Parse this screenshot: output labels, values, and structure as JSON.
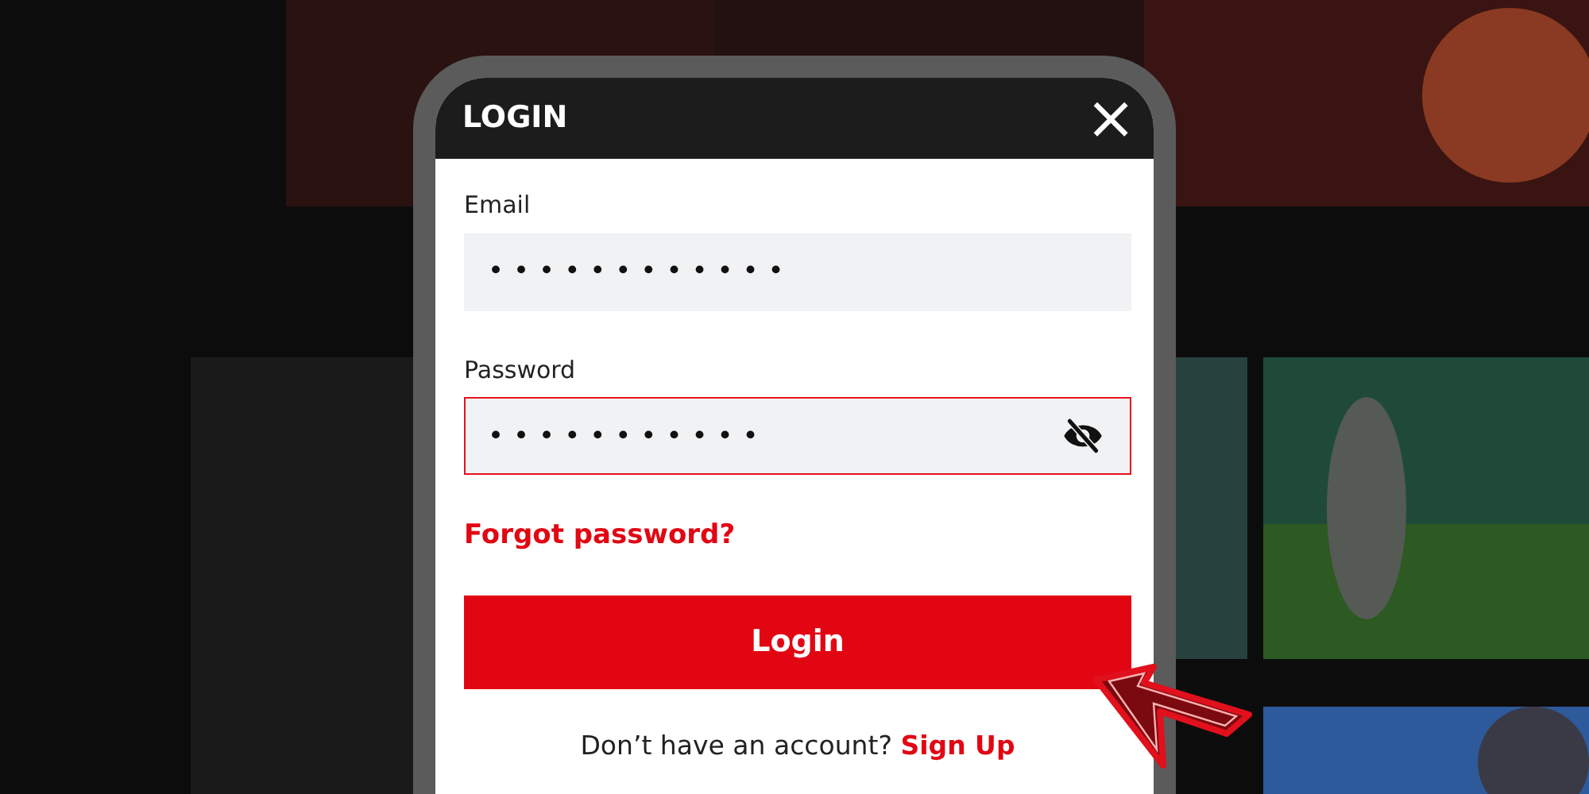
{
  "dialog": {
    "title": "LOGIN",
    "close": "×"
  },
  "fields": [
    {
      "label": "Email",
      "value": "••••••••••••",
      "error": false
    },
    {
      "label": "Password",
      "value": "•••••••••••",
      "error": true,
      "reveal_toggle": true
    }
  ],
  "forgot_link": "Forgot password?",
  "submit": "Login",
  "signup": {
    "prompt": "Don’t have an account?",
    "link": "Sign Up"
  }
}
